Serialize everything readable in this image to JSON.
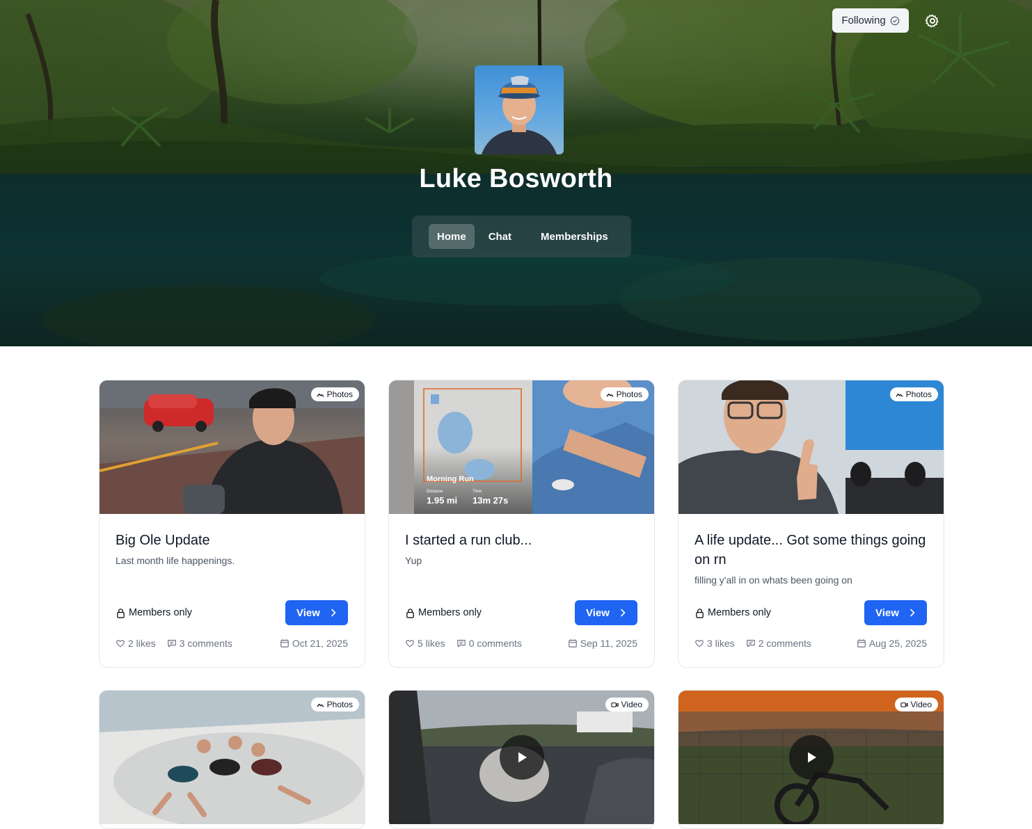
{
  "header": {
    "follow_label": "Following",
    "profile_name": "Luke Bosworth",
    "tabs": [
      {
        "label": "Home",
        "active": true
      },
      {
        "label": "Chat",
        "active": false
      },
      {
        "label": "Memberships",
        "active": false
      }
    ]
  },
  "accent_color": "#1f64f2",
  "posts": [
    {
      "badge": "Photos",
      "title": "Big Ole Update",
      "desc": "Last month life happenings.",
      "access": "Members only",
      "button": "View",
      "likes": "2 likes",
      "comments": "3 comments",
      "date": "Oct 21, 2025"
    },
    {
      "badge": "Photos",
      "title": "I started a run club...",
      "desc": "Yup",
      "access": "Members only",
      "button": "View",
      "likes": "5 likes",
      "comments": "0 comments",
      "date": "Sep 11, 2025",
      "map": {
        "name": "Morning Run",
        "distance_label": "Distance",
        "distance": "1.95 mi",
        "time_label": "Time",
        "time": "13m 27s"
      }
    },
    {
      "badge": "Photos",
      "title": "A life update... Got some things going on rn",
      "desc": "filling y'all in on whats been going on",
      "access": "Members only",
      "button": "View",
      "likes": "3 likes",
      "comments": "2 comments",
      "date": "Aug 25, 2025"
    },
    {
      "badge": "Photos"
    },
    {
      "badge": "Video"
    },
    {
      "badge": "Video"
    }
  ]
}
